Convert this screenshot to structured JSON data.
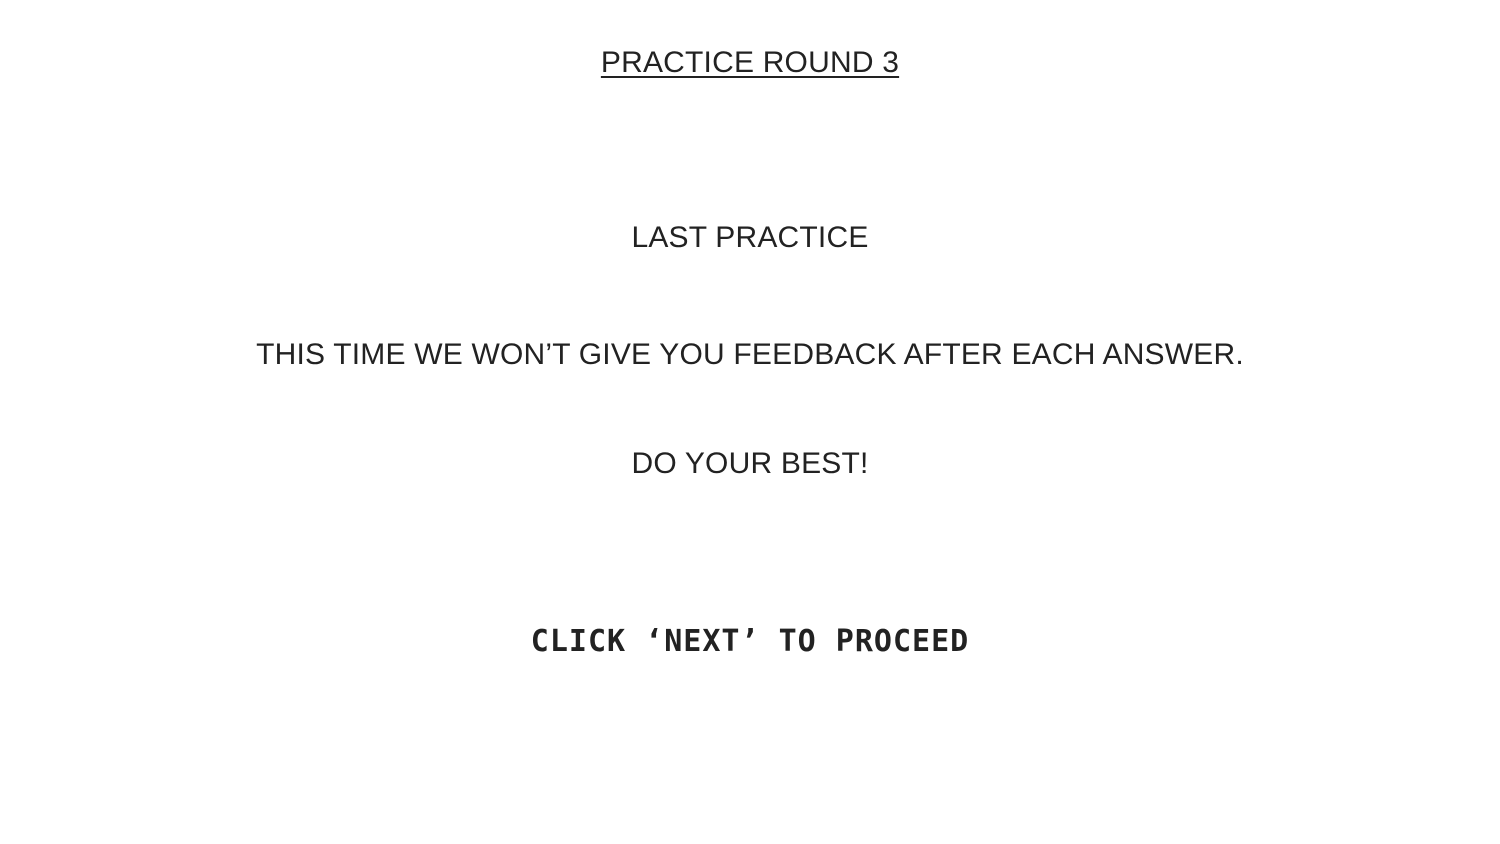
{
  "slide": {
    "title": "PRACTICE ROUND 3",
    "subtitle": "LAST PRACTICE",
    "message": "THIS TIME WE WON’T GIVE YOU FEEDBACK AFTER EACH ANSWER.",
    "encouragement": "DO YOUR BEST!",
    "instruction": "CLICK ‘NEXT’ TO PROCEED"
  },
  "colors": {
    "background": "#ffffff",
    "text": "#222222"
  }
}
